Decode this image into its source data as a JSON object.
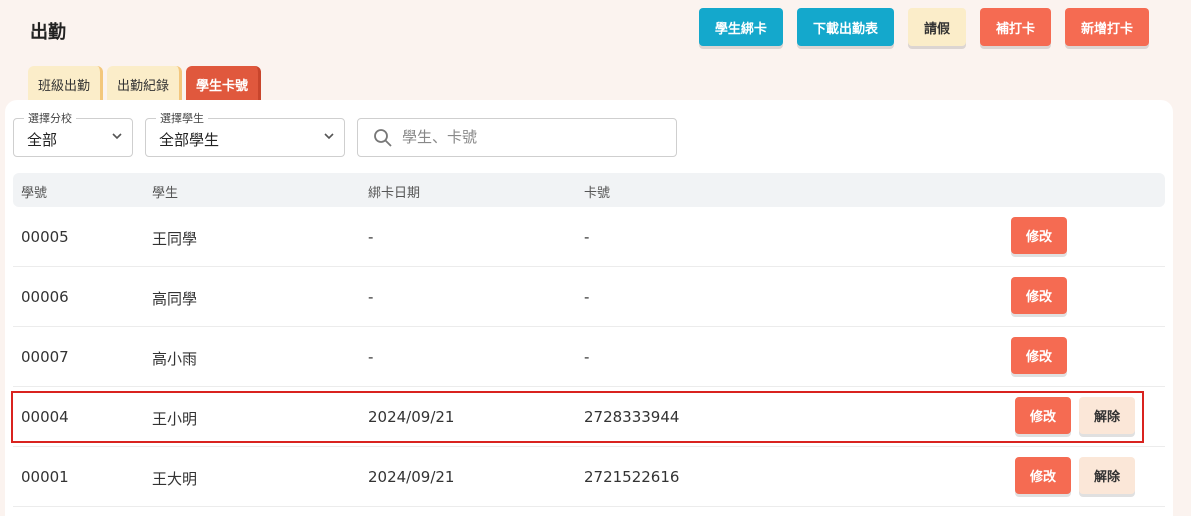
{
  "page_title": "出勤",
  "actions": {
    "bind_card": "學生綁卡",
    "download_attendance": "下載出勤表",
    "leave": "請假",
    "make_up_punch": "補打卡",
    "add_punch": "新增打卡"
  },
  "tabs": [
    "班級出勤",
    "出勤紀錄",
    "學生卡號"
  ],
  "filters": {
    "branch": {
      "label": "選擇分校",
      "value": "全部"
    },
    "student": {
      "label": "選擇學生",
      "value": "全部學生"
    },
    "search_placeholder": "學生、卡號"
  },
  "table": {
    "headers": [
      "學號",
      "學生",
      "綁卡日期",
      "卡號"
    ],
    "edit_label": "修改",
    "unbind_label": "解除",
    "rows": [
      {
        "id": "00005",
        "name": "王同學",
        "date": "-",
        "card": "-"
      },
      {
        "id": "00006",
        "name": "高同學",
        "date": "-",
        "card": "-"
      },
      {
        "id": "00007",
        "name": "高小雨",
        "date": "-",
        "card": "-"
      },
      {
        "id": "00004",
        "name": "王小明",
        "date": "2024/09/21",
        "card": "2728333944"
      },
      {
        "id": "00001",
        "name": "王大明",
        "date": "2024/09/21",
        "card": "2721522616"
      }
    ]
  },
  "colors": {
    "accent": "#f56b52",
    "teal": "#14a8cc",
    "highlight": "#d9231f"
  }
}
